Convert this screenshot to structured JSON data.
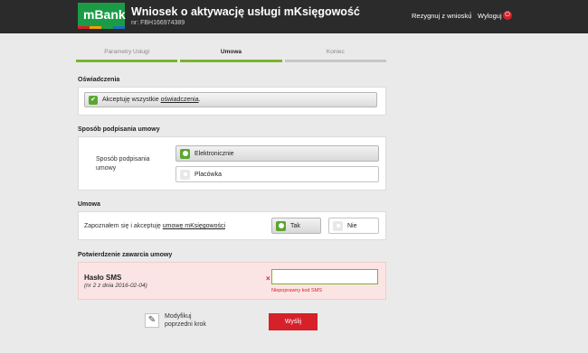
{
  "header": {
    "logo_text": "mBank",
    "title": "Wniosek o aktywację usługi mKsięgowość",
    "subtitle": "nr: FBH166974389",
    "resign_link": "Rezygnuj z wniosku",
    "separator": "|",
    "logout_link": "Wyloguj",
    "colors": {
      "brand_green": "#1b9b46",
      "bg": "#2b2b2b",
      "logout_red": "#d6202a"
    }
  },
  "steps": [
    {
      "label": "Parametry Usługi",
      "state": "done"
    },
    {
      "label": "Umowa",
      "state": "active"
    },
    {
      "label": "Koniec",
      "state": "pending"
    }
  ],
  "declarations": {
    "section_title": "Oświadczenia",
    "accept_prefix": "Akceptuję wszystkie ",
    "accept_link": "oświadczenia",
    "accept_suffix": ".",
    "checked": true
  },
  "signing": {
    "section_title": "Sposób podpisania umowy",
    "field_label": "Sposób podpisania umowy",
    "options": [
      {
        "label": "Elektronicznie",
        "selected": true
      },
      {
        "label": "Placówka",
        "selected": false
      }
    ]
  },
  "agreement": {
    "section_title": "Umowa",
    "text_prefix": "Zapoznałem się i akceptuję ",
    "text_link": "umowę mKsięgowości",
    "options": [
      {
        "label": "Tak",
        "selected": true
      },
      {
        "label": "Nie",
        "selected": false
      }
    ]
  },
  "confirmation": {
    "section_title": "Potwierdzenie zawarcia umowy",
    "sms_label": "Hasło SMS",
    "sms_sub": "(nr 2 z dnia 2016-02-04)",
    "error_mark": "×",
    "input_value": "",
    "error_message": "Niepoprawny kod SMS"
  },
  "footer": {
    "modify_label": "Modyfikuj poprzedni krok",
    "send_label": "Wyślij"
  }
}
